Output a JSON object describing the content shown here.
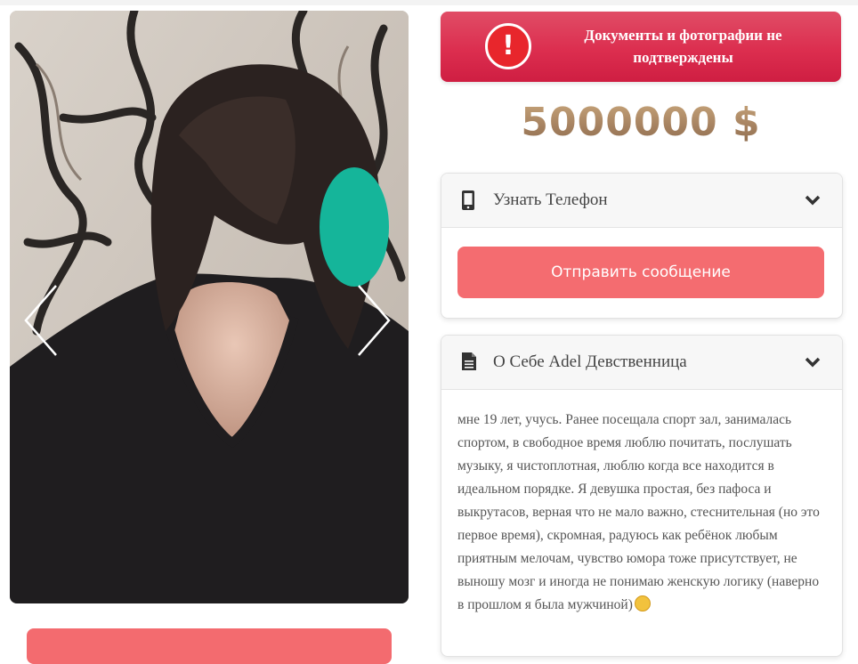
{
  "alert": {
    "icon": "exclamation-icon",
    "mark": "!",
    "text": "Документы и фотографии не подтверждены",
    "color": "#dc2e4f"
  },
  "price": {
    "value": "5000000",
    "currency": "$"
  },
  "phone_panel": {
    "icon": "mobile-phone-icon",
    "title": "Узнать Телефон",
    "chevron": "chevron-down-icon",
    "send_button": "Отправить сообщение",
    "button_color": "#f46c70"
  },
  "about_panel": {
    "icon": "document-icon",
    "title": "О Себе Adel Девственница",
    "chevron": "chevron-down-icon",
    "text": "мне 19 лет, учусь. Ранее посещала спорт зал, занималась спортом, в свободное время люблю почитать, послушать музыку, я чистоплотная, люблю когда все находится в идеальном порядке. Я девушка простая, без пафоса и выкрутасов, верная что не мало важно, стеснительная (но это первое время), скромная, радуюсь как ребёнок любым приятным мелочам, чувство юмора тоже присутствует, не выношу мозг и иногда не понимаю женскую логику (наверно в прошлом я была мужчиной)",
    "emoji": "grinning-sweat-emoji"
  },
  "gallery": {
    "prev_icon": "chevron-left-icon",
    "next_icon": "chevron-right-icon"
  }
}
